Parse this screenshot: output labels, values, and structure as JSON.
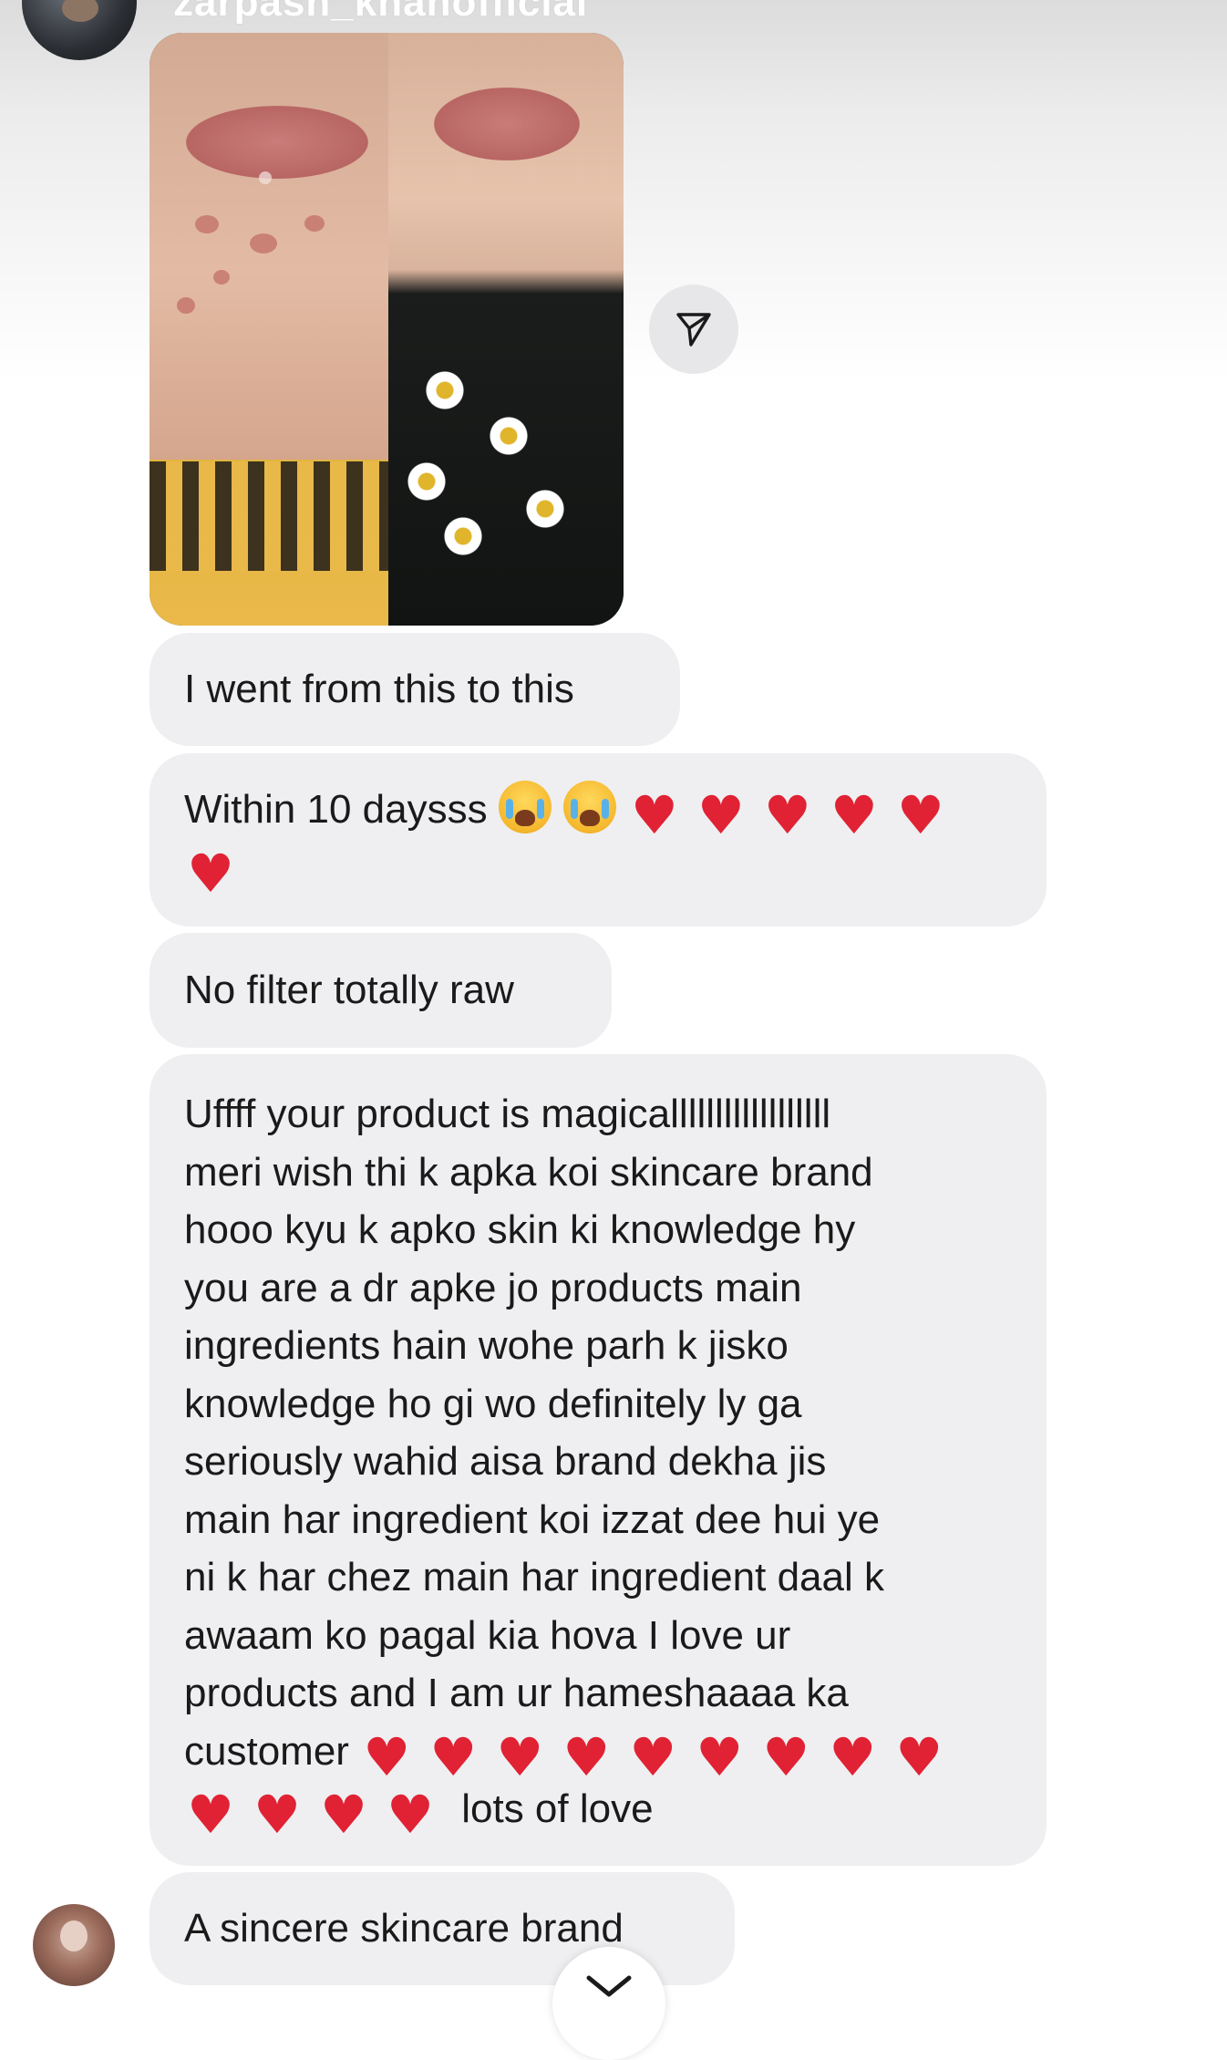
{
  "header": {
    "username": "zarpash_khanofficial"
  },
  "messages": [
    {
      "text": "I went from this to this"
    },
    {
      "text": "Within 10 daysss",
      "emoji": [
        "loudly-crying-face",
        "loudly-crying-face",
        "red-heart",
        "red-heart",
        "red-heart",
        "red-heart",
        "red-heart",
        "red-heart"
      ]
    },
    {
      "text": "No filter totally raw"
    },
    {
      "lines": [
        "Uffff your product is magicallllllllllllllllll",
        "meri wish thi k apka koi skincare brand",
        "hooo kyu k apko skin ki knowledge hy",
        "you are a dr apke jo products main",
        "ingredients hain wohe parh k jisko",
        "knowledge ho gi wo definitely ly ga",
        "seriously wahid aisa brand dekha jis",
        "main har ingredient koi izzat dee hui ye",
        "ni k har chez main har ingredient daal k",
        "awaam ko pagal kia hova I love ur",
        "products and I am ur hameshaaaa ka",
        "customer",
        "lots of love"
      ]
    },
    {
      "text": "A sincere skincare brand"
    }
  ],
  "icons": {
    "share": "paper-plane-icon",
    "scroll": "chevron-down-icon",
    "heart": "red-heart-emoji",
    "cry": "loudly-crying-face-emoji"
  },
  "colors": {
    "bubble": "#efeff1",
    "heart": "#e02234",
    "text": "#1a1a1a"
  }
}
